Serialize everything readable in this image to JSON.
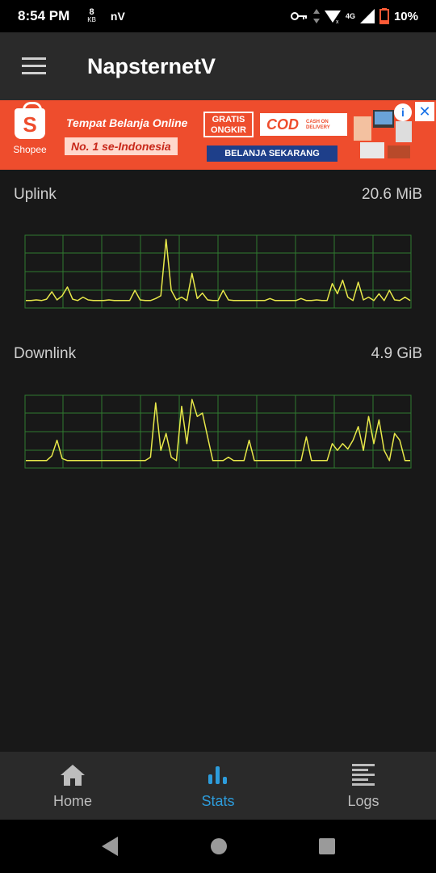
{
  "status_bar": {
    "time": "8:54 PM",
    "speed_value": "8",
    "speed_unit": "KB",
    "app_indicator": "nV",
    "network": "4G",
    "battery": "10%",
    "icons": [
      "key-icon",
      "data-arrows-icon",
      "wifi-icon",
      "signal-icon",
      "battery-icon"
    ]
  },
  "app_bar": {
    "title": "NapsternetV",
    "menu_icon": "hamburger-menu-icon"
  },
  "ad": {
    "brand": "Shopee",
    "tagline": "Tempat Belanja Online",
    "tagline2": "No. 1 se-Indonesia",
    "gratis": "GRATIS ONGKIR",
    "cod": "COD",
    "cod_sub": "CASH ON DELIVERY",
    "cta": "BELANJA SEKARANG",
    "info_icon": "i",
    "close_icon": "✕",
    "accent": "#ee4d2d"
  },
  "stats": {
    "uplink": {
      "label": "Uplink",
      "value": "20.6 MiB"
    },
    "downlink": {
      "label": "Downlink",
      "value": "4.9 GiB"
    },
    "line_color": "#e8e84a",
    "grid_color": "#2f7a2f"
  },
  "chart_data": [
    {
      "type": "line",
      "series": [
        {
          "values": [
            0.05,
            0.05,
            0.06,
            0.05,
            0.07,
            0.18,
            0.06,
            0.12,
            0.25,
            0.07,
            0.05,
            0.1,
            0.06,
            0.05,
            0.05,
            0.05,
            0.06,
            0.05,
            0.05,
            0.05,
            0.05,
            0.2,
            0.06,
            0.05,
            0.05,
            0.08,
            0.12,
            0.95,
            0.2,
            0.06,
            0.1,
            0.05,
            0.45,
            0.08,
            0.16,
            0.06,
            0.05,
            0.05,
            0.2,
            0.06,
            0.05,
            0.05,
            0.05,
            0.05,
            0.05,
            0.05,
            0.05,
            0.08,
            0.05,
            0.05,
            0.05,
            0.05,
            0.05,
            0.08,
            0.05,
            0.05,
            0.06,
            0.05,
            0.05,
            0.3,
            0.15,
            0.35,
            0.1,
            0.05,
            0.32,
            0.06,
            0.1,
            0.05,
            0.15,
            0.05,
            0.2,
            0.06,
            0.05,
            0.1,
            0.05
          ]
        }
      ],
      "ylim": [
        0,
        1
      ],
      "grid": true
    },
    {
      "type": "line",
      "series": [
        {
          "values": [
            0.05,
            0.05,
            0.05,
            0.05,
            0.05,
            0.12,
            0.35,
            0.08,
            0.05,
            0.05,
            0.05,
            0.05,
            0.05,
            0.05,
            0.05,
            0.05,
            0.05,
            0.05,
            0.05,
            0.05,
            0.05,
            0.05,
            0.05,
            0.05,
            0.1,
            0.9,
            0.2,
            0.45,
            0.1,
            0.05,
            0.85,
            0.3,
            0.95,
            0.7,
            0.75,
            0.4,
            0.05,
            0.05,
            0.05,
            0.1,
            0.05,
            0.05,
            0.05,
            0.35,
            0.05,
            0.05,
            0.05,
            0.05,
            0.05,
            0.05,
            0.05,
            0.05,
            0.05,
            0.05,
            0.4,
            0.05,
            0.05,
            0.05,
            0.05,
            0.3,
            0.2,
            0.3,
            0.22,
            0.35,
            0.55,
            0.2,
            0.7,
            0.3,
            0.65,
            0.2,
            0.05,
            0.45,
            0.35,
            0.05,
            0.05
          ]
        }
      ],
      "ylim": [
        0,
        1
      ],
      "grid": true
    }
  ],
  "bottom_nav": {
    "items": [
      {
        "label": "Home",
        "icon": "home-icon",
        "active": false
      },
      {
        "label": "Stats",
        "icon": "bar-chart-icon",
        "active": true
      },
      {
        "label": "Logs",
        "icon": "list-icon",
        "active": false
      }
    ]
  },
  "system_nav": {
    "icons": [
      "back-icon",
      "home-circle-icon",
      "recents-icon"
    ]
  }
}
